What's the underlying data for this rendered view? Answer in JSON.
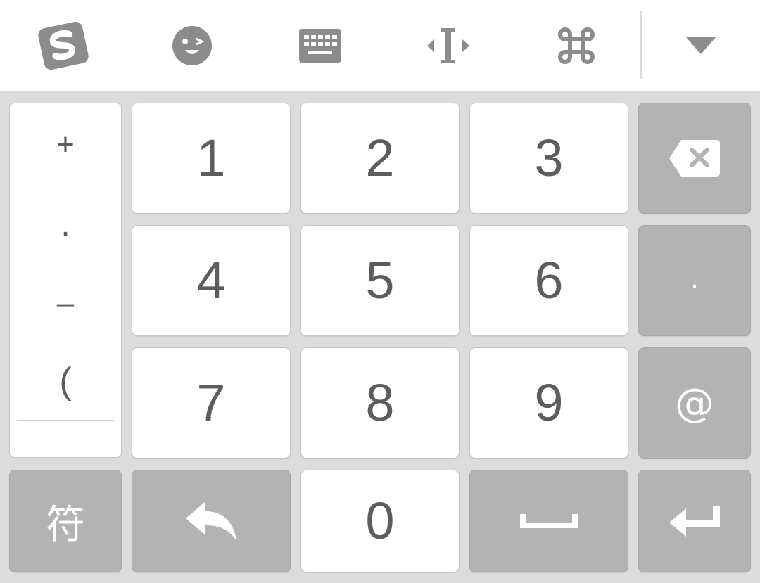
{
  "toolbar": {
    "items": [
      {
        "name": "sogou-logo-icon"
      },
      {
        "name": "emoji-icon"
      },
      {
        "name": "keyboard-icon"
      },
      {
        "name": "cursor-move-icon"
      },
      {
        "name": "command-icon"
      },
      {
        "name": "collapse-chevron-icon"
      }
    ]
  },
  "symbol_column": {
    "items": [
      "+",
      ".",
      "–",
      "("
    ]
  },
  "keys": {
    "digits": [
      "1",
      "2",
      "3",
      "4",
      "5",
      "6",
      "7",
      "8",
      "9",
      "0"
    ],
    "dot": ".",
    "at": "@",
    "symbols": "符"
  },
  "colors": {
    "key_light": "#ffffff",
    "key_dark": "#b3b3b3",
    "background": "#dcdcdc",
    "icon_gray": "#8c8c8c",
    "text_gray": "#5d5d5d"
  }
}
